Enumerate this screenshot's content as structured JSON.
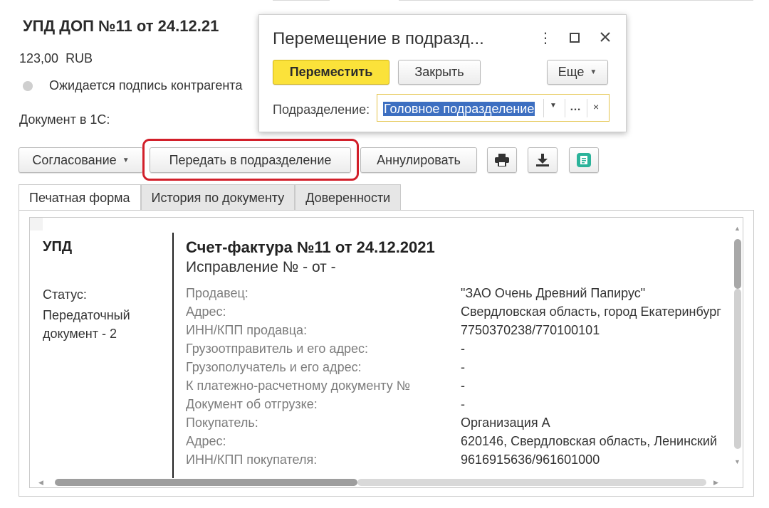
{
  "document": {
    "title": "УПД ДОП №11 от 24.12.21",
    "amount": "123,00",
    "currency": "RUB",
    "status_text": "Ожидается подпись контрагента",
    "doc_in_1c_label": "Документ в 1С:"
  },
  "toolbar": {
    "approval_label": "Согласование",
    "transfer_label": "Передать в подразделение",
    "annul_label": "Аннулировать",
    "icons": [
      "printer-icon",
      "download-icon",
      "document-icon"
    ]
  },
  "tabs": [
    {
      "label": "Печатная форма",
      "active": true
    },
    {
      "label": "История по документу",
      "active": false
    },
    {
      "label": "Доверенности",
      "active": false
    }
  ],
  "print_form": {
    "doc_type": "УПД",
    "status_label": "Статус:",
    "status_value": "Передаточный документ - 2",
    "invoice_title": "Счет-фактура №11 от 24.12.2021",
    "correction": "Исправление № - от -",
    "rows": [
      {
        "key": "Продавец:",
        "value": "\"ЗАО Очень Древний Папирус\""
      },
      {
        "key": "Адрес:",
        "value": "Свердловская область, город Екатеринбург"
      },
      {
        "key": "ИНН/КПП продавца:",
        "value": "7750370238/770100101"
      },
      {
        "key": "Грузоотправитель и его адрес:",
        "value": "-"
      },
      {
        "key": "Грузополучатель и его адрес:",
        "value": "-"
      },
      {
        "key": "К платежно-расчетному документу №",
        "value": "-"
      },
      {
        "key": "Документ об отгрузке:",
        "value": "-"
      },
      {
        "key": "Покупатель:",
        "value": "Организация А"
      },
      {
        "key": "Адрес:",
        "value": "620146, Свердловская область, Ленинский"
      },
      {
        "key": "ИНН/КПП покупателя:",
        "value": "9616915636/961601000"
      }
    ]
  },
  "dialog": {
    "title": "Перемещение в подразд...",
    "move_label": "Переместить",
    "close_label": "Закрыть",
    "more_label": "Еще",
    "field_label": "Подразделение:",
    "field_value": "Головное подразделение"
  },
  "colors": {
    "primary_button": "#fbe23a",
    "highlight_frame": "#d21f2a",
    "selection": "#3d6fc1",
    "field_border": "#e4c44a"
  }
}
